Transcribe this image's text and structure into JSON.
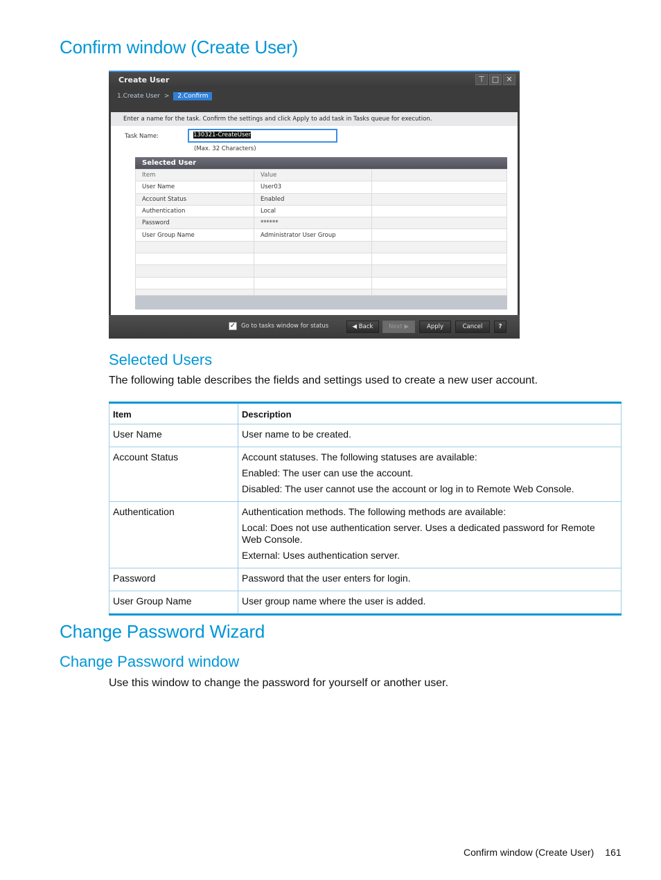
{
  "headings": {
    "confirm_window": "Confirm window (Create User)",
    "selected_users": "Selected Users",
    "change_password_wizard": "Change Password Wizard",
    "change_password_window": "Change Password window"
  },
  "paragraphs": {
    "selected_users_intro": "The following table describes the fields and settings used to create a new user account.",
    "change_password_intro": "Use this window to change the password for yourself or another user."
  },
  "dialog": {
    "title": "Create User",
    "controls": [
      "pin-icon",
      "maximize-icon",
      "close-icon"
    ],
    "steps": [
      {
        "label": "1.Create User",
        "active": false
      },
      {
        "label": "2.Confirm",
        "active": true
      }
    ],
    "step_separator": ">",
    "instruction": "Enter a name for the task. Confirm the settings and click Apply to add task in Tasks queue for execution.",
    "task_name_label": "Task Name:",
    "task_name_value": "130321-CreateUser",
    "task_name_hint": "(Max. 32 Characters)",
    "selected_user": {
      "title": "Selected User",
      "columns": [
        "Item",
        "Value",
        ""
      ],
      "rows": [
        {
          "item": "User Name",
          "value": "User03"
        },
        {
          "item": "Account Status",
          "value": "Enabled"
        },
        {
          "item": "Authentication",
          "value": "Local"
        },
        {
          "item": "Password",
          "value": "******"
        },
        {
          "item": "User Group Name",
          "value": "Administrator User Group"
        }
      ]
    },
    "footer": {
      "checkbox_label": "Go to tasks window for status",
      "checkbox_checked": true,
      "back": "Back",
      "next": "Next",
      "apply": "Apply",
      "cancel": "Cancel",
      "help": "?"
    }
  },
  "doc_table": {
    "headers": [
      "Item",
      "Description"
    ],
    "rows": [
      {
        "item": "User Name",
        "desc": [
          "User name to be created."
        ]
      },
      {
        "item": "Account Status",
        "desc": [
          "Account statuses. The following statuses are available:",
          "Enabled: The user can use the account.",
          "Disabled: The user cannot use the account or log in to Remote Web Console."
        ]
      },
      {
        "item": "Authentication",
        "desc": [
          "Authentication methods. The following methods are available:",
          "Local: Does not use authentication server. Uses a dedicated password for Remote Web Console.",
          "External: Uses authentication server."
        ]
      },
      {
        "item": "Password",
        "desc": [
          "Password that the user enters for login."
        ]
      },
      {
        "item": "User Group Name",
        "desc": [
          "User group name where the user is added."
        ]
      }
    ]
  },
  "footer": {
    "section": "Confirm window (Create User)",
    "page_number": "161"
  },
  "colors": {
    "heading_blue": "#0096d6",
    "table_rule": "#0096d6",
    "step_active": "#2f7fd6"
  }
}
